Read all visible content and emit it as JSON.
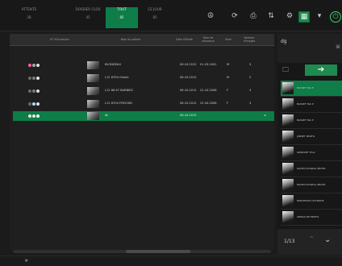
{
  "tabs": [
    {
      "label": "ATTENTE",
      "count": "28"
    },
    {
      "label": "DOSSIER CLOS",
      "count": "45"
    },
    {
      "label": "TOUT",
      "count": "85"
    },
    {
      "label": "CE JOUR",
      "count": "85"
    }
  ],
  "toolbar_icons": [
    "add-user-icon",
    "refresh-icon",
    "print-icon",
    "usb-icon",
    "patient-icon",
    "green-panel-icon",
    "dropdown-icon",
    "power-icon"
  ],
  "table": {
    "headers": [
      "N° d'Accession",
      "Nom du patient",
      "Date d'étude",
      "Date de naissance",
      "Sexe",
      "Nombre d'images"
    ],
    "rows": [
      {
        "dots": [
          "#ff5fa8",
          "#aaaaaa",
          "#e0e0e0"
        ],
        "name": "BLONDEAU",
        "study": "06.10.2012",
        "birth": "01.03.2001",
        "sex": "M",
        "count": "3"
      },
      {
        "dots": [
          "#6a6a6a",
          "#7d7d7d",
          "#e0e0e0"
        ],
        "name": "L12 8794 Girolle",
        "study": "06.10.2012",
        "birth": "",
        "sex": "M",
        "count": "2"
      },
      {
        "dots": [
          "#6a6a6a",
          "#7d7d7d",
          "#e0e0e0"
        ],
        "name": "L12 86 67 BARBIEZ",
        "study": "06.10.2012",
        "birth": "22.10.2008",
        "sex": "F",
        "count": "3"
      },
      {
        "dots": [
          "#6a6a6a",
          "#aee3ff",
          "#e0e0e0"
        ],
        "name": "L12 8704 FRECHIN",
        "study": "06.10.2012",
        "birth": "22.04.2008",
        "sex": "F",
        "count": "3"
      },
      {
        "dots": [
          "#e8e8e8",
          "#e8e8e8",
          "#ffffff"
        ],
        "name": "At",
        "study": "06.10.2012",
        "birth": "",
        "sex": "",
        "count": ""
      }
    ]
  },
  "right_panel": {
    "patient_name": "dg",
    "series": [
      "BASSET Fab P",
      "BASSET Fab P",
      "BASSET Fab P",
      "JANSET PROFIL",
      "GENOUET FtoA",
      "RACHIS DORSAL PROFIL",
      "RACHIS DORSAL PROFIL",
      "PROCESSUS STYBLIDE",
      "GENOU DE PROFIL"
    ],
    "page_indicator": "1/13"
  },
  "colors": {
    "accent": "#0f7d48",
    "background": "#1b1b1b"
  }
}
